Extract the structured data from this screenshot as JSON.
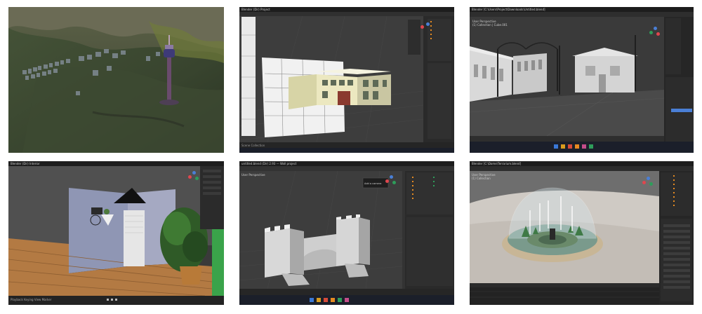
{
  "tiles": {
    "t2": {
      "header_title": "Blender (Dir) Project",
      "status_text": "Scene Collection"
    },
    "t3": {
      "header_title": "Blender [C:\\Users\\Project\\Downloads\\Untitled.blend]",
      "view_label": "User Perspective",
      "collection_label": "(1) Collection | Cube.001"
    },
    "t4": {
      "header_title": "Blender (Dir) Interior",
      "bottom_text": "Playback  Keying  View  Marker"
    },
    "t5": {
      "header_title": "untitled.blend (Dir) 2.93 — Wall project",
      "view_label": "User Perspective",
      "tooltip": "Add a camera"
    },
    "t6": {
      "header_title": "Blender [C:\\Dome\\Terrarium.blend]",
      "view_label": "User Perspective",
      "collection_label": "(1) Collection"
    }
  },
  "colors": {
    "ui_dark": "#2b2b2b",
    "ui_header": "#1d1d1d",
    "accent_orange": "#e58a21",
    "accent_blue": "#4a7fd6",
    "taskbar": "#1b1f2a"
  }
}
